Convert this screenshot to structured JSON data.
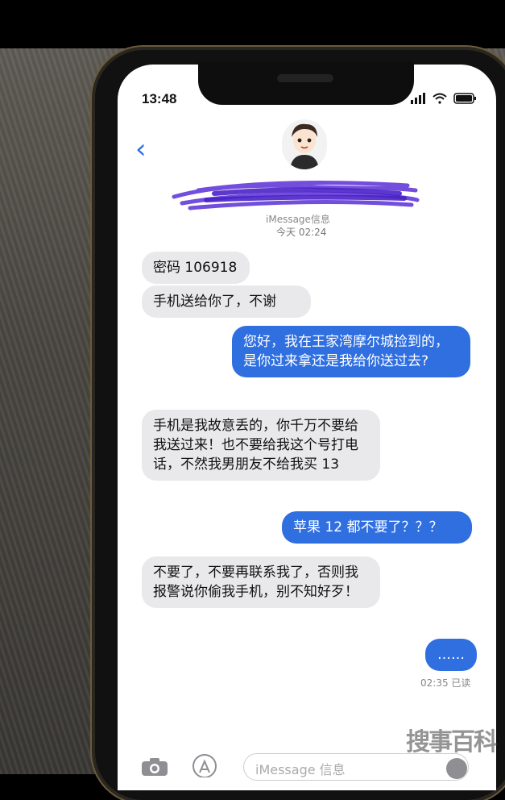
{
  "status_bar": {
    "time": "13:48"
  },
  "header": {
    "service_label": "iMessage信息",
    "timestamp": "今天 02:24"
  },
  "messages": [
    {
      "dir": "in",
      "text": "密码 106918"
    },
    {
      "dir": "in",
      "text": "手机送给你了，不谢"
    },
    {
      "dir": "out",
      "text": "您好，我在王家湾摩尔城捡到的，是你过来拿还是我给你送过去?"
    },
    {
      "dir": "in",
      "text": "手机是我故意丢的，你千万不要给我送过来！也不要给我这个号打电话，不然我男朋友不给我买 13"
    },
    {
      "dir": "out",
      "text": "苹果 12 都不要了？？？"
    },
    {
      "dir": "in",
      "text": "不要了，不要再联系我了，否则我报警说你偷我手机，别不知好歹！"
    },
    {
      "dir": "out",
      "text": "……"
    }
  ],
  "receipt": "02:35 已读",
  "composer": {
    "placeholder": "iMessage 信息"
  },
  "watermark": "搜事百科",
  "icons": {
    "back": "chevron-left-icon",
    "camera": "camera-icon",
    "apps": "app-store-icon",
    "mic": "audio-icon"
  },
  "colors": {
    "outgoing": "#2f6fe0",
    "incoming": "#e9e9eb",
    "link": "#2f6fe0"
  }
}
